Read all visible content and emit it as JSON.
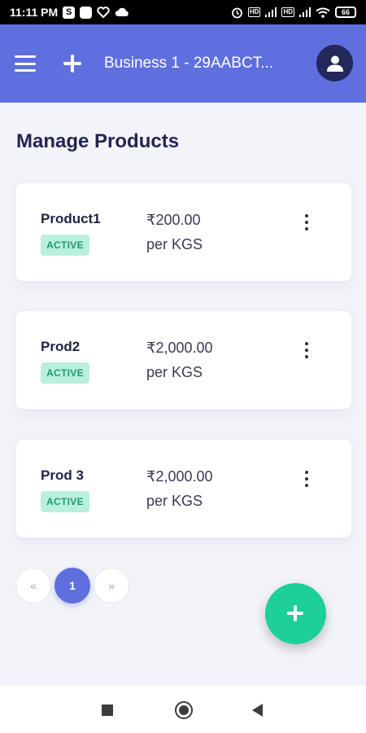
{
  "status_bar": {
    "time": "11:11 PM",
    "battery": "66"
  },
  "app_bar": {
    "title": "Business 1 - 29AABCT..."
  },
  "page": {
    "title": "Manage Products"
  },
  "products": [
    {
      "name": "Product1",
      "status": "ACTIVE",
      "price": "₹200.00",
      "unit": "per KGS"
    },
    {
      "name": "Prod2",
      "status": "ACTIVE",
      "price": "₹2,000.00",
      "unit": "per KGS"
    },
    {
      "name": "Prod 3",
      "status": "ACTIVE",
      "price": "₹2,000.00",
      "unit": "per KGS"
    }
  ],
  "pagination": {
    "prev": "«",
    "current": "1",
    "next": "»"
  },
  "colors": {
    "app_bar": "#5f6fde",
    "badge_bg": "#b9f0dc",
    "badge_text": "#1f9b70",
    "fab": "#1fcf98",
    "avatar": "#23295a"
  }
}
